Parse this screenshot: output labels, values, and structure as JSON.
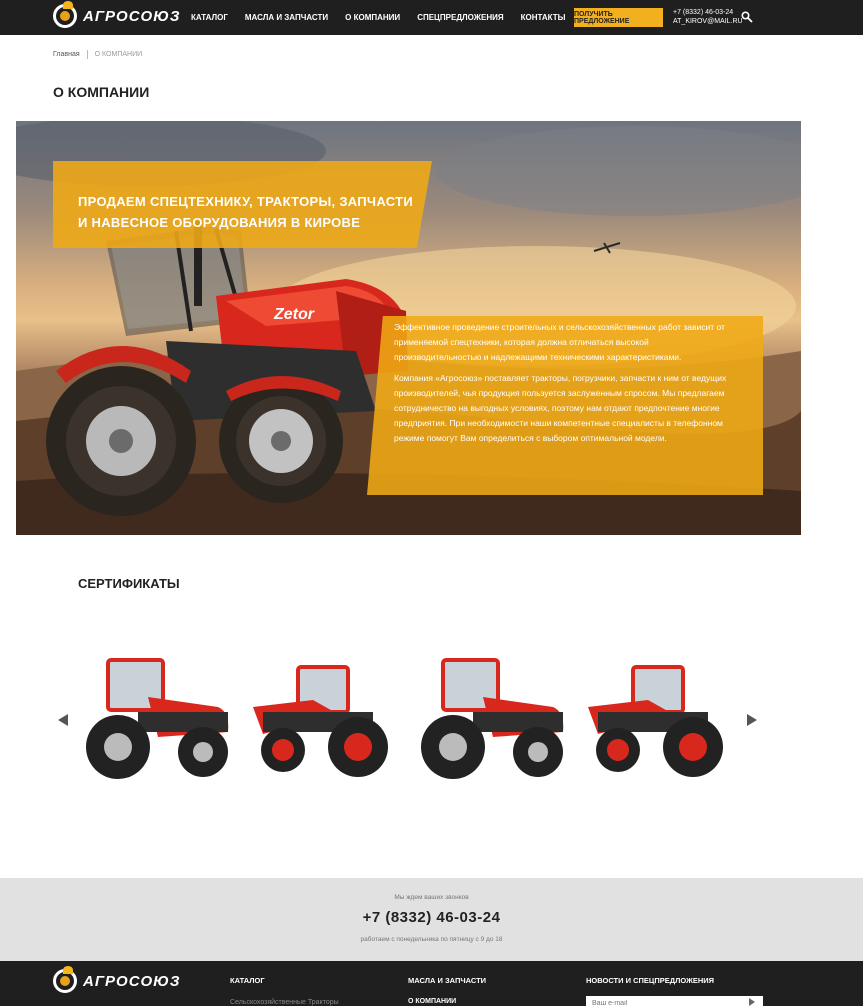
{
  "header": {
    "logo_text": "АГРОСОЮЗ",
    "nav": [
      "Каталог",
      "Масла и запчасти",
      "О компании",
      "Спецпредложения",
      "Контакты"
    ],
    "offer_button": "Получить предложение",
    "phone": "+7 (8332) 46-03-24",
    "email": "AT_KIROV@MAIL.RU",
    "search_icon": "search-icon"
  },
  "breadcrumb": {
    "home": "Главная",
    "current": "О КОМПАНИИ"
  },
  "page_title": "О КОМПАНИИ",
  "hero": {
    "headline_line1": "Продаем спецтехнику, тракторы, запчасти",
    "headline_line2": "и навесное оборудования в Кирове",
    "paragraph1": "Эффективное проведение строительных и сельскохозяйственных работ зависит от применяемой спецтехники, которая должна отличаться высокой производительностью и надлежащими техническими характеристиками.",
    "paragraph2": "Компания «Агросоюз» поставляет тракторы, погрузчики, запчасти к ним от ведущих производителей, чья продукция пользуется заслуженным спросом. Мы предлагаем сотрудничество на выгодных условиях, поэтому нам отдают предпочтение многие предприятия. При необходимости наши компетентные специалисты в телефонном режиме помогут Вам определиться с выбором оптимальной модели.",
    "brand_on_tractor": "Zetor"
  },
  "certificates": {
    "title": "Сертификаты",
    "items_count": 4
  },
  "callback": {
    "small": "Мы ждем ваших звонков",
    "phone": "+7 (8332) 46-03-24",
    "hours": "работаем с понедельника по пятницу с 9 до 18"
  },
  "footer": {
    "logo_text": "АГРОСОЮЗ",
    "col1_title": "Каталог",
    "col1_link": "Сельскохозяйственные Тракторы",
    "col2_title": "Масла и запчасти",
    "col2_link": "О компании",
    "col3_title": "Новости и спецпредложения",
    "email_placeholder": "Ваш e-mail"
  },
  "colors": {
    "accent": "#f2b01e",
    "dark": "#1f1f1f",
    "tractor_red": "#d8281e"
  }
}
